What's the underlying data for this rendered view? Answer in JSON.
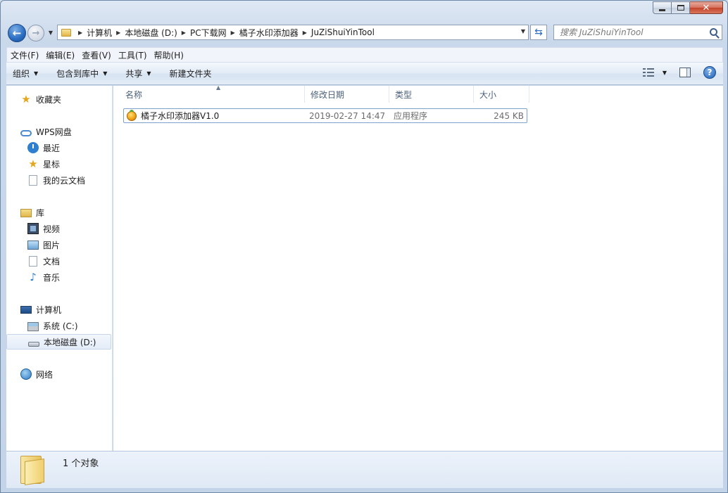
{
  "window": {
    "caption_buttons": [
      "minimize",
      "maximize",
      "close"
    ]
  },
  "address_bar": {
    "crumbs": [
      "计算机",
      "本地磁盘 (D:)",
      "PC下载网",
      "橘子水印添加器",
      "JuZiShuiYinTool"
    ]
  },
  "search": {
    "placeholder": "搜索 JuZiShuiYinTool"
  },
  "menubar": {
    "items": [
      "文件(F)",
      "编辑(E)",
      "查看(V)",
      "工具(T)",
      "帮助(H)"
    ]
  },
  "toolbar": {
    "organize": "组织",
    "include_in_library": "包含到库中",
    "share": "共享",
    "new_folder": "新建文件夹"
  },
  "navpane": {
    "favorites": "收藏夹",
    "wps": "WPS网盘",
    "recent": "最近",
    "starred": "星标",
    "cloud_docs": "我的云文档",
    "libraries": "库",
    "videos": "视频",
    "pictures": "图片",
    "documents": "文档",
    "music": "音乐",
    "computer": "计算机",
    "drive_c": "系统 (C:)",
    "drive_d": "本地磁盘 (D:)",
    "network": "网络"
  },
  "columns": {
    "name": "名称",
    "modified": "修改日期",
    "type": "类型",
    "size": "大小"
  },
  "files": [
    {
      "name": "橘子水印添加器V1.0",
      "modified": "2019-02-27 14:47",
      "type": "应用程序",
      "size": "245 KB"
    }
  ],
  "details": {
    "status": "1 个对象"
  },
  "colors": {
    "selection_border": "#7da2ce",
    "chrome": "#c4d4e8",
    "accent": "#2a6cc0"
  }
}
